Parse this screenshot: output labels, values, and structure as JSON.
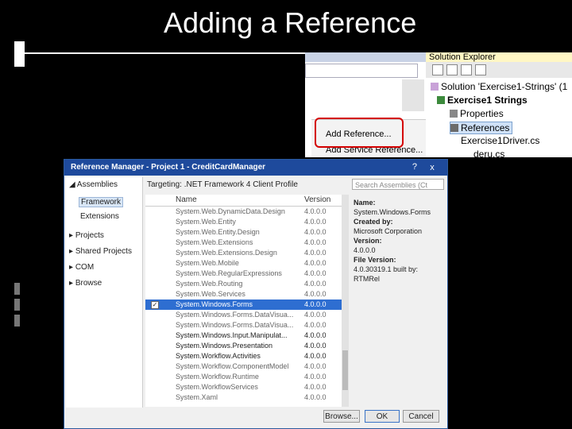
{
  "slide": {
    "title": "Adding a Reference"
  },
  "solution": {
    "menu": [
      "Add Reference...",
      "Add Service Reference..."
    ],
    "explorer_title": "Solution Explorer",
    "tree": [
      "Solution 'Exercise1-Strings' (1",
      "Exercise1 Strings",
      "Properties",
      "References",
      "Exercise1Driver.cs",
      "deru.cs"
    ]
  },
  "dialog": {
    "title": "Reference Manager - Project 1 - CreditCardManager",
    "help": "?",
    "close": "x",
    "nav": {
      "assemblies": "Assemblies",
      "framework": "Framework",
      "extensions": "Extensions",
      "projects": "Projects",
      "shared": "Shared Projects",
      "com": "COM",
      "browse": "Browse"
    },
    "targeting": "Targeting: .NET Framework 4 Client Profile",
    "search_placeholder": "Search Assemblies (Ct",
    "columns": {
      "name": "Name",
      "version": "Version"
    },
    "rows": [
      {
        "name": "System.Web.DynamicData.Design",
        "version": "4.0.0.0"
      },
      {
        "name": "System.Web.Entity",
        "version": "4.0.0.0"
      },
      {
        "name": "System.Web.Entity.Design",
        "version": "4.0.0.0"
      },
      {
        "name": "System.Web.Extensions",
        "version": "4.0.0.0"
      },
      {
        "name": "System.Web.Extensions.Design",
        "version": "4.0.0.0"
      },
      {
        "name": "System.Web.Mobile",
        "version": "4.0.0.0"
      },
      {
        "name": "System.Web.RegularExpressions",
        "version": "4.0.0.0"
      },
      {
        "name": "System.Web.Routing",
        "version": "4.0.0.0"
      },
      {
        "name": "System.Web.Services",
        "version": "4.0.0.0"
      },
      {
        "name": "System.Windows.Forms",
        "version": "4.0.0.0"
      },
      {
        "name": "System.Windows.Forms.DataVisua...",
        "version": "4.0.0.0"
      },
      {
        "name": "System.Windows.Forms.DataVisua...",
        "version": "4.0.0.0"
      },
      {
        "name": "System.Windows.Input.Manipulat...",
        "version": "4.0.0.0"
      },
      {
        "name": "System.Windows.Presentation",
        "version": "4.0.0.0"
      },
      {
        "name": "System.Workflow.Activities",
        "version": "4.0.0.0"
      },
      {
        "name": "System.Workflow.ComponentModel",
        "version": "4.0.0.0"
      },
      {
        "name": "System.Workflow.Runtime",
        "version": "4.0.0.0"
      },
      {
        "name": "System.WorkflowServices",
        "version": "4.0.0.0"
      },
      {
        "name": "System.Xaml",
        "version": "4.0.0.0"
      }
    ],
    "selected_row": 9,
    "details": {
      "name_label": "Name:",
      "name": "System.Windows.Forms",
      "created_label": "Created by:",
      "created": "Microsoft Corporation",
      "version_label": "Version:",
      "version": "4.0.0.0",
      "file_version_label": "File Version:",
      "file_version": "4.0.30319.1 built by:",
      "built": "RTMRel"
    },
    "buttons": {
      "browse": "Browse...",
      "ok": "OK",
      "cancel": "Cancel"
    }
  }
}
